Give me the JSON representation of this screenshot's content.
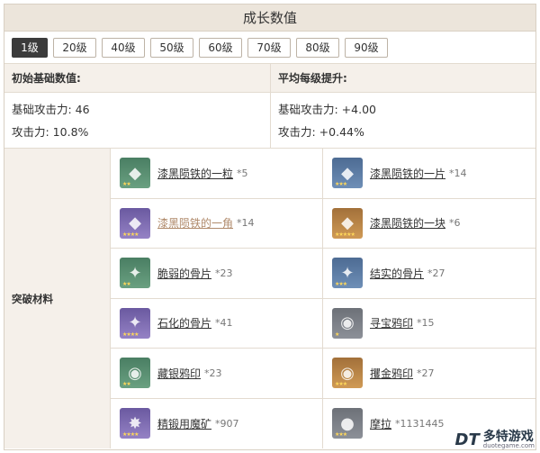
{
  "header": {
    "title": "成长数值"
  },
  "levels": [
    "1级",
    "20级",
    "40级",
    "50级",
    "60级",
    "70级",
    "80级",
    "90级"
  ],
  "active_level": "1级",
  "stats": {
    "left_header": "初始基础数值:",
    "right_header": "平均每级提升:",
    "left": [
      "基础攻击力: 46",
      "攻击力: 10.8%"
    ],
    "right": [
      "基础攻击力: +4.00",
      "攻击力: +0.44%"
    ]
  },
  "materials": {
    "label": "突破材料",
    "items": [
      {
        "name": "漆黑陨铁的一粒",
        "count": "*5",
        "quality": "q2",
        "icon": "ore-grain-icon",
        "stars": "★★"
      },
      {
        "name": "漆黑陨铁的一片",
        "count": "*14",
        "quality": "q3",
        "icon": "ore-piece-icon",
        "stars": "★★★"
      },
      {
        "name": "漆黑陨铁的一角",
        "count": "*14",
        "quality": "q4",
        "icon": "ore-corner-icon",
        "stars": "★★★★"
      },
      {
        "name": "漆黑陨铁的一块",
        "count": "*6",
        "quality": "q5",
        "icon": "ore-block-icon",
        "stars": "★★★★★"
      },
      {
        "name": "脆弱的骨片",
        "count": "*23",
        "quality": "q2",
        "icon": "fragile-bone-icon",
        "stars": "★★"
      },
      {
        "name": "结实的骨片",
        "count": "*27",
        "quality": "q3",
        "icon": "sturdy-bone-icon",
        "stars": "★★★"
      },
      {
        "name": "石化的骨片",
        "count": "*41",
        "quality": "q4",
        "icon": "fossil-bone-icon",
        "stars": "★★★★"
      },
      {
        "name": "寻宝鸦印",
        "count": "*15",
        "quality": "q1",
        "icon": "treasure-crow-icon",
        "stars": "★"
      },
      {
        "name": "藏银鸦印",
        "count": "*23",
        "quality": "q2",
        "icon": "silver-raven-icon",
        "stars": "★★"
      },
      {
        "name": "攫金鸦印",
        "count": "*27",
        "quality": "q5",
        "icon": "golden-raven-icon",
        "stars": "★★★"
      },
      {
        "name": "精锻用魔矿",
        "count": "*907",
        "quality": "q4",
        "icon": "mystic-ore-icon",
        "stars": "★★★★"
      },
      {
        "name": "摩拉",
        "count": "*1131445",
        "quality": "q1",
        "icon": "mora-icon",
        "stars": "★★★"
      }
    ]
  },
  "watermark": {
    "logo": "DT",
    "cn": "多特游戏",
    "en": "duotegame.com"
  }
}
